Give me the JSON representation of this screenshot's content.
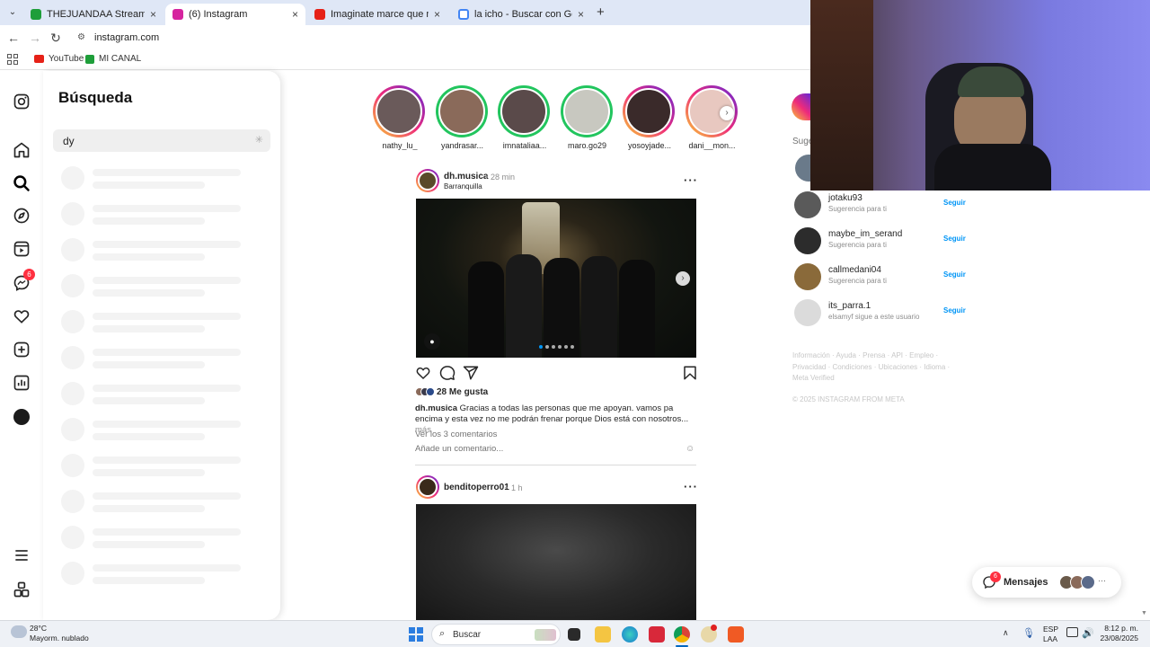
{
  "browser": {
    "tabs": [
      {
        "title": "THEJUANDAA Stream - Watch L",
        "favicon_color": "#1e9e3a"
      },
      {
        "title": "(6) Instagram",
        "favicon_color": "#d6249f"
      },
      {
        "title": "Imaginate marce que me van a",
        "favicon_color": "#e62117"
      },
      {
        "title": "la icho - Buscar con Google",
        "favicon_color": "#4285f4"
      }
    ],
    "url": "instagram.com",
    "bookmarks": [
      {
        "label": "YouTube",
        "color": "#e62117"
      },
      {
        "label": "MI CANAL",
        "color": "#1e9e3a"
      }
    ]
  },
  "search": {
    "title": "Búsqueda",
    "query": "dy",
    "skeleton_rows": 12
  },
  "nav": {
    "icons": [
      "instagram-icon",
      "home-icon",
      "search-icon",
      "explore-icon",
      "reels-icon",
      "messenger-icon",
      "heart-icon",
      "create-icon",
      "dashboard-icon",
      "profile-avatar",
      "menu-icon",
      "threads-icon"
    ],
    "messenger_badge": "6"
  },
  "stories": [
    {
      "name": "nathy_lu_",
      "ring": "gradient"
    },
    {
      "name": "yandrasar...",
      "ring": "green"
    },
    {
      "name": "imnataliaa...",
      "ring": "green"
    },
    {
      "name": "maro.go29",
      "ring": "green"
    },
    {
      "name": "yosoyjade...",
      "ring": "gradient"
    },
    {
      "name": "dani__mon...",
      "ring": "gradient"
    }
  ],
  "post1": {
    "user": "dh.musica",
    "time": "28 min",
    "location": "Barranquilla",
    "likes": "28 Me gusta",
    "caption_user": "dh.musica",
    "caption": "Gracias a todas las personas que me apoyan. vamos pa encima y esta vez no me podrán frenar porque Dios está con nosotros...",
    "more": "más",
    "view_comments": "Ver los 3 comentarios",
    "add_comment": "Añade un comentario...",
    "separator": "•"
  },
  "post2": {
    "user": "benditoperro01",
    "time": "1 h"
  },
  "suggestions": {
    "header": "Sugerencias para ti",
    "items": [
      {
        "name": "jotaku93",
        "sub": "Sugerencia para ti",
        "action": "Seguir",
        "color": "#5a5a5a"
      },
      {
        "name": "maybe_im_serand",
        "sub": "Sugerencia para ti",
        "action": "Seguir",
        "color": "#2c2c2c"
      },
      {
        "name": "callmedani04",
        "sub": "Sugerencia para ti",
        "action": "Seguir",
        "color": "#8a6a3a"
      },
      {
        "name": "its_parra.1",
        "sub": "elsamyf sigue a este usuario",
        "action": "Seguir",
        "color": "#dbdbdb"
      }
    ],
    "footer_links": "Información · Ayuda · Prensa · API · Empleo · Privacidad · Condiciones · Ubicaciones · Idioma · Meta Verified",
    "copyright": "© 2025 INSTAGRAM FROM META"
  },
  "messages": {
    "label": "Mensajes",
    "badge": "6"
  },
  "taskbar": {
    "weather_temp": "28°C",
    "weather_desc": "Mayorm. nublado",
    "search_placeholder": "Buscar",
    "lang_top": "ESP",
    "lang_bottom": "LAA",
    "time": "8:12 p. m.",
    "date": "23/08/2025"
  }
}
